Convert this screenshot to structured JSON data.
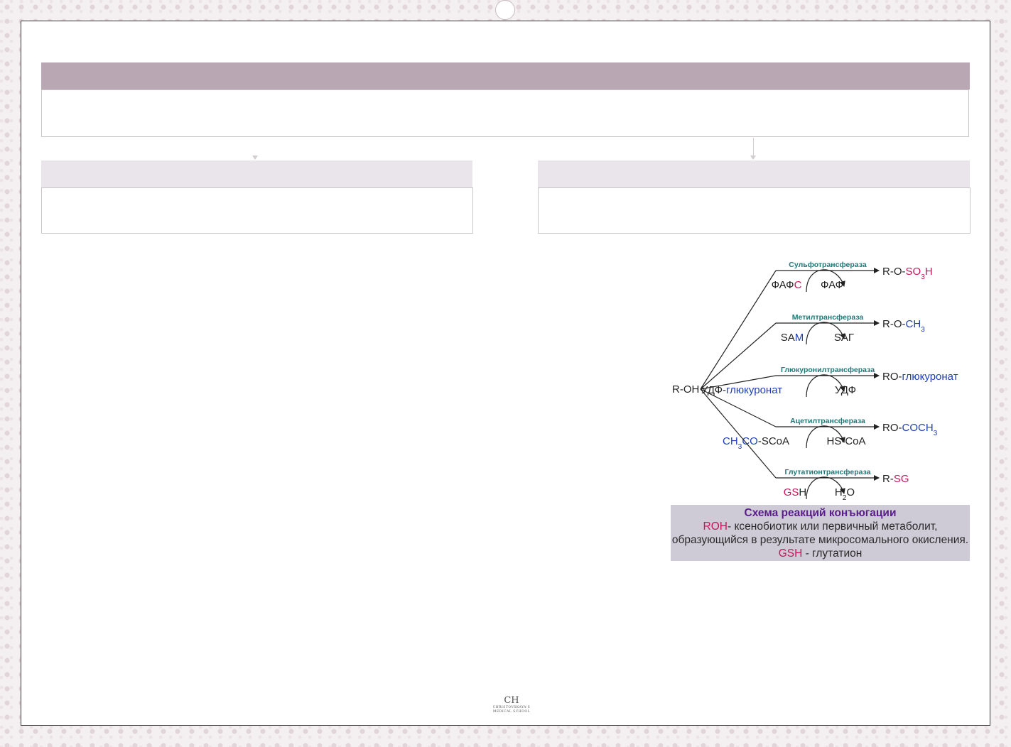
{
  "scheme": {
    "substrate": "R-OH",
    "reactions": [
      {
        "enzyme": "Сульфотрансфераза",
        "donor": [
          {
            "t": "ФАФ",
            "c": "#222222"
          },
          {
            "t": "С",
            "c": "#c2185b"
          }
        ],
        "byproduct": [
          {
            "t": "ФАФ",
            "c": "#222222"
          }
        ],
        "product": [
          {
            "t": "R-O-",
            "c": "#222222"
          },
          {
            "t": "SO",
            "c": "#c2185b"
          },
          {
            "t": "3",
            "c": "#c2185b",
            "sub": true
          },
          {
            "t": "H",
            "c": "#c2185b"
          }
        ]
      },
      {
        "enzyme": "Метилтрансфераза",
        "donor": [
          {
            "t": "SA",
            "c": "#222222"
          },
          {
            "t": "M",
            "c": "#1f3fb3"
          }
        ],
        "byproduct": [
          {
            "t": "SAГ",
            "c": "#222222"
          }
        ],
        "product": [
          {
            "t": "R-O-",
            "c": "#222222"
          },
          {
            "t": "CH",
            "c": "#1f3fb3"
          },
          {
            "t": "3",
            "c": "#1f3fb3",
            "sub": true
          }
        ]
      },
      {
        "enzyme": "Глюкуронилтрансфераза",
        "donor": [
          {
            "t": "УДФ-",
            "c": "#222222"
          },
          {
            "t": "глюкуронат",
            "c": "#1f3fb3"
          }
        ],
        "byproduct": [
          {
            "t": "УДФ",
            "c": "#222222"
          }
        ],
        "product": [
          {
            "t": "RO-",
            "c": "#222222"
          },
          {
            "t": "глюкуронат",
            "c": "#1f3fb3"
          }
        ]
      },
      {
        "enzyme": "Ацетилтрансфераза",
        "donor": [
          {
            "t": "CH",
            "c": "#1f3fb3"
          },
          {
            "t": "3",
            "c": "#1f3fb3",
            "sub": true
          },
          {
            "t": "CO",
            "c": "#1f3fb3"
          },
          {
            "t": "-SCoA",
            "c": "#222222"
          }
        ],
        "byproduct": [
          {
            "t": "HS-CoA",
            "c": "#222222"
          }
        ],
        "product": [
          {
            "t": "RO-",
            "c": "#222222"
          },
          {
            "t": "COCH",
            "c": "#1f3fb3"
          },
          {
            "t": "3",
            "c": "#1f3fb3",
            "sub": true
          }
        ]
      },
      {
        "enzyme": "Глутатионтрансфераза",
        "donor": [
          {
            "t": "GS",
            "c": "#c2185b"
          },
          {
            "t": "H",
            "c": "#222222"
          }
        ],
        "byproduct": [
          {
            "t": "H",
            "c": "#222222"
          },
          {
            "t": "2",
            "c": "#222222",
            "sub": true
          },
          {
            "t": "O",
            "c": "#222222"
          }
        ],
        "product": [
          {
            "t": "R-",
            "c": "#222222"
          },
          {
            "t": "SG",
            "c": "#c2185b"
          }
        ]
      }
    ]
  },
  "caption": {
    "title": "Схема реакций конъюгации",
    "roh": "ROH",
    "text1": "- ксенобиотик или первичный метаболит, образующийся в результате микросомального окисления.",
    "gsh": "GSH",
    "text2": " - глутатион"
  },
  "footer": {
    "monogram": "CH",
    "line1": "CHRISTOVSKAYA'S",
    "line2": "MEDICAL SCHOOL"
  },
  "colors": {
    "enzyme": "#1b7a78",
    "blue": "#1f3fb3",
    "magenta": "#c2185b",
    "caption_title": "#5a1d8a",
    "header_bar": "#b9a8b4",
    "sub_bar": "#e9e5eb"
  }
}
